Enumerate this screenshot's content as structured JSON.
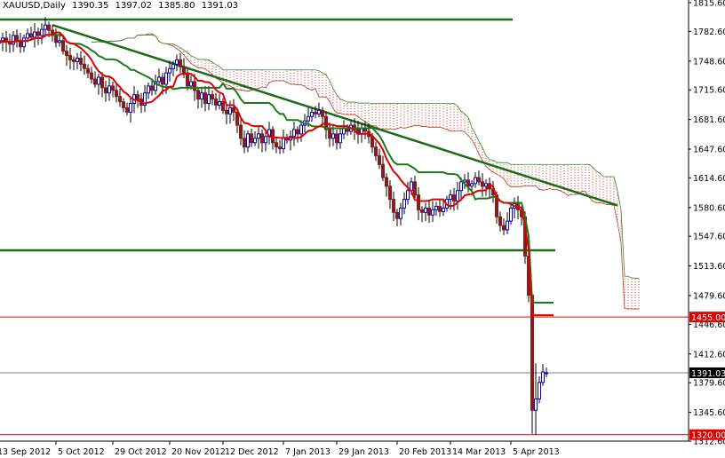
{
  "header": {
    "symbol": "XAUUSD,Daily",
    "open": "1390.35",
    "high": "1397.02",
    "low": "1385.80",
    "close": "1391.03"
  },
  "colors": {
    "bull": "#0000cc",
    "bear": "#8b1a1a",
    "tenkan": "#e00000",
    "kijun": "#1a7a1a",
    "cloud_up": "#2e8b2e",
    "cloud_down": "#c0392b",
    "trendline": "#1a6b1a",
    "support_red": "#e00000",
    "price_line": "#808080",
    "tag_red": "#e00000",
    "tag_black": "#000000"
  },
  "chart_data": {
    "type": "candlestick",
    "title": "XAUUSD,Daily",
    "ylim": [
      1312.6,
      1815.6
    ],
    "y_ticks": [
      "1815.60",
      "1782.60",
      "1748.60",
      "1715.60",
      "1681.60",
      "1647.60",
      "1614.60",
      "1580.60",
      "1547.60",
      "1513.60",
      "1479.60",
      "1446.60",
      "1412.60",
      "1379.60",
      "1345.60",
      "1312.60"
    ],
    "date_labels": [
      {
        "label": "13 Sep 2012",
        "bar": 0
      },
      {
        "label": "5 Oct 2012",
        "bar": 16
      },
      {
        "label": "29 Oct 2012",
        "bar": 32
      },
      {
        "label": "20 Nov 2012",
        "bar": 48
      },
      {
        "label": "12 Dec 2012",
        "bar": 63
      },
      {
        "label": "7 Jan 2013",
        "bar": 80
      },
      {
        "label": "29 Jan 2013",
        "bar": 95
      },
      {
        "label": "20 Feb 2013",
        "bar": 112
      },
      {
        "label": "14 Mar 2013",
        "bar": 127
      },
      {
        "label": "5 Apr 2013",
        "bar": 144
      }
    ],
    "closes": [
      1772,
      1775,
      1770,
      1768,
      1778,
      1772,
      1765,
      1775,
      1780,
      1776,
      1782,
      1778,
      1785,
      1790,
      1784,
      1778,
      1770,
      1772,
      1760,
      1755,
      1750,
      1748,
      1752,
      1745,
      1740,
      1735,
      1728,
      1722,
      1730,
      1718,
      1712,
      1720,
      1715,
      1708,
      1702,
      1695,
      1690,
      1700,
      1710,
      1705,
      1698,
      1712,
      1720,
      1715,
      1725,
      1730,
      1722,
      1735,
      1740,
      1745,
      1750,
      1742,
      1735,
      1720,
      1725,
      1715,
      1705,
      1712,
      1700,
      1710,
      1705,
      1698,
      1702,
      1692,
      1688,
      1695,
      1690,
      1675,
      1660,
      1650,
      1665,
      1655,
      1660,
      1665,
      1655,
      1662,
      1670,
      1655,
      1650,
      1648,
      1660,
      1658,
      1662,
      1670,
      1665,
      1675,
      1680,
      1685,
      1690,
      1688,
      1692,
      1685,
      1670,
      1660,
      1665,
      1655,
      1665,
      1672,
      1668,
      1675,
      1670,
      1665,
      1672,
      1668,
      1662,
      1650,
      1640,
      1630,
      1615,
      1605,
      1590,
      1575,
      1568,
      1580,
      1590,
      1600,
      1610,
      1595,
      1578,
      1575,
      1580,
      1572,
      1578,
      1582,
      1576,
      1580,
      1590,
      1595,
      1588,
      1600,
      1610,
      1612,
      1605,
      1608,
      1615,
      1610,
      1605,
      1608,
      1602,
      1595,
      1570,
      1560,
      1555,
      1565,
      1580,
      1585,
      1578,
      1570,
      1525,
      1480,
      1348,
      1361,
      1380,
      1392,
      1391.03
    ],
    "special_bars": {
      "150": {
        "o": 1480,
        "h": 1482,
        "l": 1321,
        "c": 1348
      },
      "151": {
        "o": 1348,
        "h": 1402,
        "l": 1320,
        "c": 1361
      },
      "154": {
        "o": 1390.35,
        "h": 1397.02,
        "l": 1385.8,
        "c": 1391.03
      }
    },
    "horizontal_lines": [
      {
        "price": 1796.3,
        "color": "trendline",
        "to_bar": 144
      },
      {
        "price": 1531.5,
        "color": "trendline",
        "to_bar": 156
      },
      {
        "price": 1455.0,
        "color": "support_red",
        "tag": "1455.00"
      },
      {
        "price": 1391.03,
        "color": "price_line",
        "tag": "1391.03"
      },
      {
        "price": 1320.0,
        "color": "support_red",
        "tag": "1320.00"
      }
    ],
    "trendline": {
      "from": {
        "bar": 15,
        "price": 1790
      },
      "to": {
        "bar": 174,
        "price": 1583
      }
    }
  }
}
